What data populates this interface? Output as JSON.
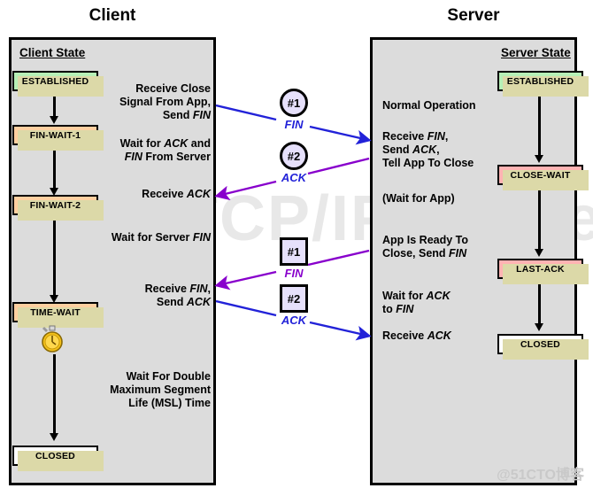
{
  "titles": {
    "client": "Client",
    "server": "Server"
  },
  "panels": {
    "client": {
      "heading": "Client State"
    },
    "server": {
      "heading": "Server State"
    }
  },
  "client_states": [
    {
      "label": "ESTABLISHED"
    },
    {
      "label": "FIN-WAIT-1"
    },
    {
      "label": "FIN-WAIT-2"
    },
    {
      "label": "TIME-WAIT"
    },
    {
      "label": "CLOSED"
    }
  ],
  "server_states": [
    {
      "label": "ESTABLISHED"
    },
    {
      "label": "CLOSE-WAIT"
    },
    {
      "label": "LAST-ACK"
    },
    {
      "label": "CLOSED"
    }
  ],
  "client_notes": [
    {
      "line1": "Receive Close",
      "line2": "Signal From App,",
      "line3": "Send FIN"
    },
    {
      "line1": "Wait for ACK and",
      "line2": "FIN From Server"
    },
    {
      "line1": "Receive ACK"
    },
    {
      "line1": "Wait for Server FIN"
    },
    {
      "line1": "Receive FIN,",
      "line2": "Send ACK"
    },
    {
      "line1": "Wait For Double",
      "line2": "Maximum Segment",
      "line3": "Life (MSL) Time"
    }
  ],
  "server_notes": [
    {
      "line1": "Normal Operation"
    },
    {
      "line1": "Receive FIN,",
      "line2": "Send ACK,",
      "line3": "Tell App To Close"
    },
    {
      "line1": "(Wait for App)"
    },
    {
      "line1": "App Is Ready To",
      "line2": "Close, Send FIN"
    },
    {
      "line1": "Wait for ACK",
      "line2": "to FIN"
    },
    {
      "line1": "Receive ACK"
    }
  ],
  "messages": [
    {
      "id": "#1",
      "label": "FIN",
      "shape": "circle",
      "direction": "client-to-server",
      "color": "#2222d8"
    },
    {
      "id": "#2",
      "label": "ACK",
      "shape": "circle",
      "direction": "server-to-client",
      "color": "#8800cc"
    },
    {
      "id": "#1",
      "label": "FIN",
      "shape": "square",
      "direction": "server-to-client",
      "color": "#8800cc"
    },
    {
      "id": "#2",
      "label": "ACK",
      "shape": "square",
      "direction": "client-to-server",
      "color": "#2222d8"
    }
  ],
  "watermarks": {
    "main": "The TCP/IP Guide",
    "corner": "@51CTO博客"
  },
  "colors": {
    "established": "#b6f0b6",
    "fin_wait": "#ffcfa0",
    "close_wait": "#ffb3b3",
    "closed": "#ffffff",
    "panel": "#dcdcdc",
    "shadow": "#dcd9a8",
    "marker": "#e6e0fb",
    "fin_arrow": "#2222d8",
    "ack_arrow": "#8800cc"
  }
}
